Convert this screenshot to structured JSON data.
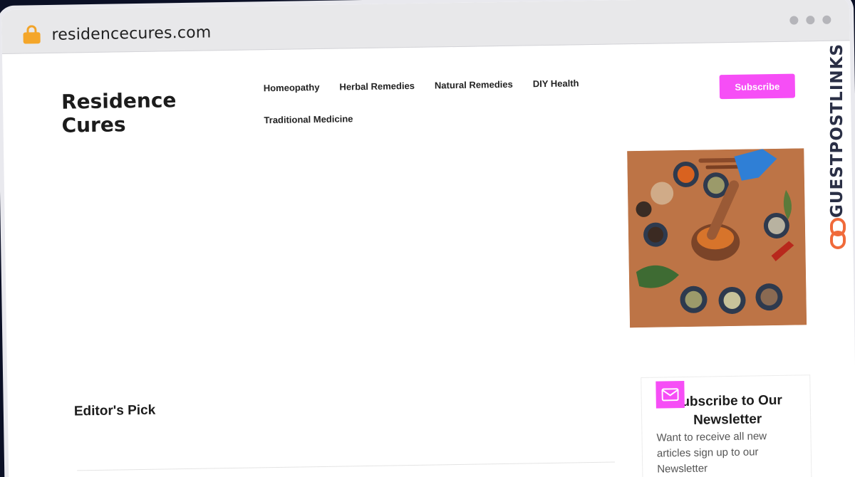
{
  "browser": {
    "url": "residencecures.com",
    "lock_icon": "lock-icon",
    "window_controls": [
      "dot",
      "dot",
      "dot"
    ]
  },
  "site": {
    "logo": "Residence Cures",
    "nav": [
      {
        "label": "Homeopathy"
      },
      {
        "label": "Herbal Remedies"
      },
      {
        "label": "Natural Remedies"
      },
      {
        "label": "DIY Health"
      },
      {
        "label": "Traditional Medicine"
      }
    ],
    "subscribe_label": "Subscribe",
    "accent_color": "#f64ef6"
  },
  "main": {
    "editors_pick": "Editor's Pick",
    "hero_image": "mortar-and-spices-image"
  },
  "sidebar": {
    "newsletter_title": "Subscribe to Our Newsletter",
    "newsletter_text": "Want to receive all new articles sign up to our Newsletter",
    "mail_icon": "mail-icon"
  },
  "watermark": {
    "text": "GUESTPOSTLINKS",
    "icon": "link-icon"
  }
}
